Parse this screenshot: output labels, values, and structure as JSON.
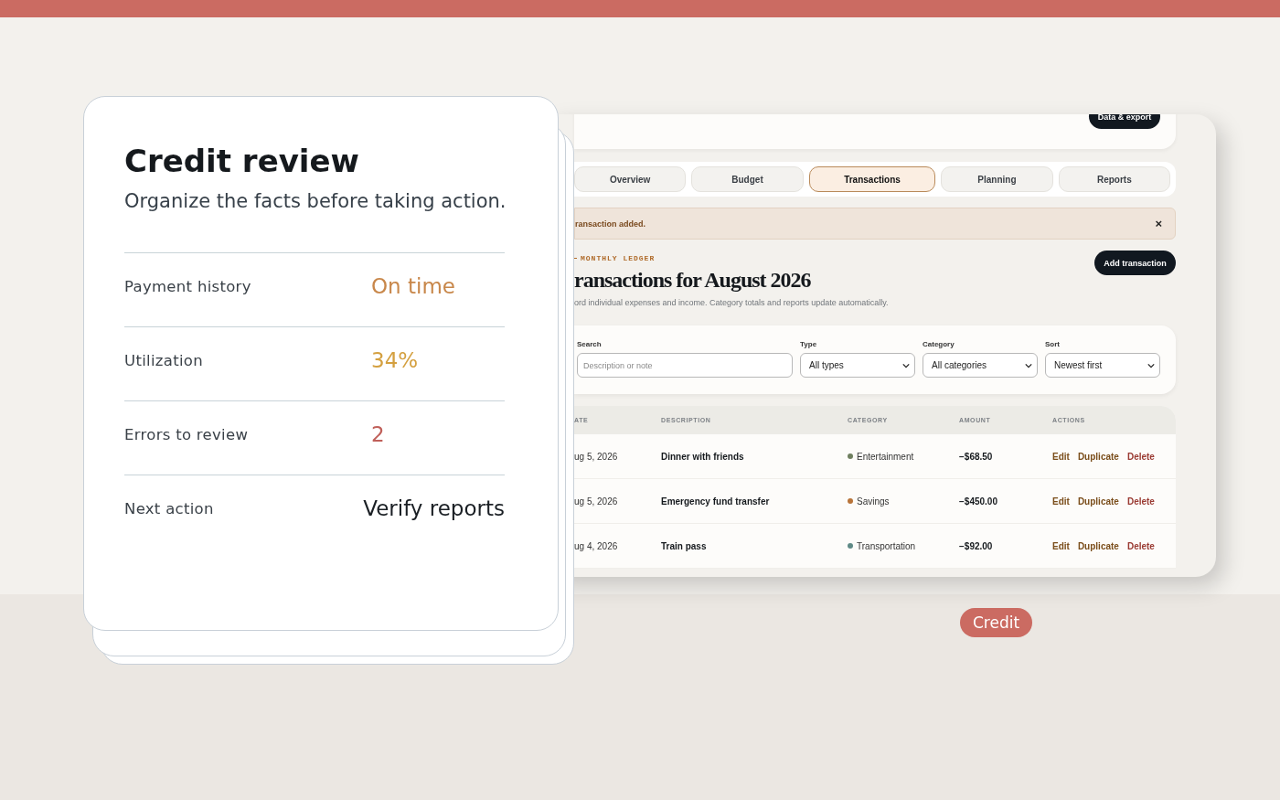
{
  "review_card": {
    "title": "Credit review",
    "subtitle": "Organize the facts before taking action.",
    "facts": [
      {
        "label": "Payment history",
        "value": "On time",
        "color": "#c8874a"
      },
      {
        "label": "Utilization",
        "value": "34%",
        "color": "#d4a040"
      },
      {
        "label": "Errors to review",
        "value": "2",
        "color": "#c0605a"
      },
      {
        "label": "Next action",
        "value": "Verify reports",
        "color": "#1a1f24"
      }
    ]
  },
  "app": {
    "header_button": "Data & export",
    "tabs": [
      {
        "label": "Overview",
        "selected": false
      },
      {
        "label": "Budget",
        "selected": false
      },
      {
        "label": "Transactions",
        "selected": true
      },
      {
        "label": "Planning",
        "selected": false
      },
      {
        "label": "Reports",
        "selected": false
      }
    ],
    "alert": {
      "message": "ransaction added.",
      "close": "×"
    },
    "eyebrow": "MONTHLY LEDGER",
    "heading": "ransactions for August 2026",
    "subheading": "ord individual expenses and income. Category totals and reports update automatically.",
    "add_button": "Add transaction",
    "filters": [
      {
        "kind": "text",
        "label": "Search",
        "placeholder": "Description or note"
      },
      {
        "kind": "select",
        "label": "Type",
        "value": "All types"
      },
      {
        "kind": "select",
        "label": "Category",
        "value": "All categories"
      },
      {
        "kind": "select",
        "label": "Sort",
        "value": "Newest first"
      }
    ],
    "table": {
      "columns": [
        "ATE",
        "DESCRIPTION",
        "CATEGORY",
        "AMOUNT",
        "ACTIONS"
      ],
      "rows": [
        {
          "date": "ug 5, 2026",
          "description": "Dinner with friends",
          "category": "Entertainment",
          "color": "#6f7f5f",
          "amount": "−$68.50",
          "actions": [
            "Edit",
            "Duplicate",
            "Delete"
          ]
        },
        {
          "date": "ug 5, 2026",
          "description": "Emergency fund transfer",
          "category": "Savings",
          "color": "#b8743a",
          "amount": "−$450.00",
          "actions": [
            "Edit",
            "Duplicate",
            "Delete"
          ]
        },
        {
          "date": "ug 4, 2026",
          "description": "Train pass",
          "category": "Transportation",
          "color": "#5f8a86",
          "amount": "−$92.00",
          "actions": [
            "Edit",
            "Duplicate",
            "Delete"
          ]
        }
      ]
    }
  },
  "tag": "Credit"
}
